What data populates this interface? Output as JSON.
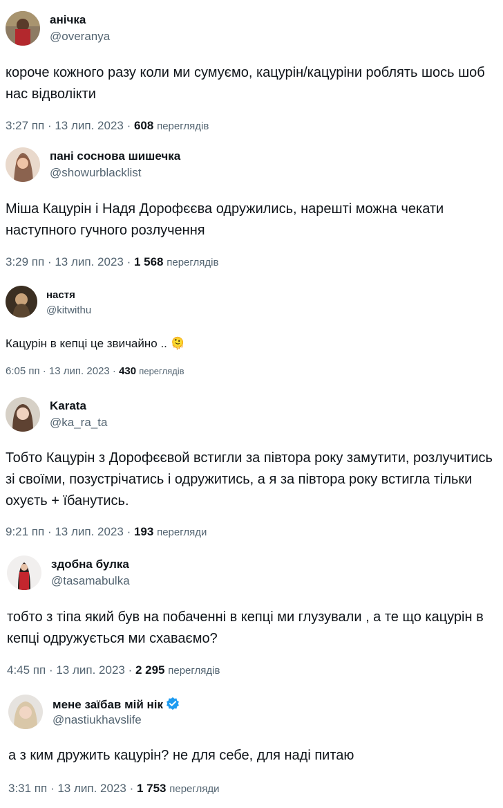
{
  "tweets": [
    {
      "name": "анічка",
      "handle": "@overanya",
      "text": "короче кожного разу коли ми сумуємо, кацурін/кацуріни роблять шось шоб нас відволікти",
      "time": "3:27 пп · 13 лип. 2023 ·",
      "views": "608",
      "views_label": "переглядів"
    },
    {
      "name": "пані соснова шишечка",
      "handle": "@showurblacklist",
      "text": "Міша Кацурін і Надя Дорофєєва одружились, нарешті можна чекати наступного гучного розлучення",
      "time": "3:29 пп · 13 лип. 2023 ·",
      "views": "1 568",
      "views_label": "переглядів"
    },
    {
      "name": "настя",
      "handle": "@kitwithu",
      "text": "Кацурін в кепці це звичайно ..",
      "emoji": "🫠",
      "time": "6:05 пп · 13 лип. 2023 ·",
      "views": "430",
      "views_label": "переглядів"
    },
    {
      "name": "Karata",
      "handle": "@ka_ra_ta",
      "text": "Тобто Кацурін з Дорофєєвой встигли за півтора року замутити, розлучитись зі своїми, позустрічатись і одружитись, а я за півтора року встигла тільки охуєть + їбанутись.",
      "time": "9:21 пп · 13 лип. 2023 ·",
      "views": "193",
      "views_label": "перегляди"
    },
    {
      "name": "здобна булка",
      "handle": "@tasamabulka",
      "text": "тобто з тіпа який був на побаченні в кепці ми глузували , а те що кацурін в кепці одружується ми схаваємо?",
      "time": "4:45 пп · 13 лип. 2023 ·",
      "views": "2 295",
      "views_label": "переглядів"
    },
    {
      "name": "мене заїбав мій нік",
      "handle": "@nastiukhavslife",
      "text": "а з ким дружить кацурін? не для себе, для наді питаю",
      "time": "3:31 пп · 13 лип. 2023 ·",
      "views": "1 753",
      "views_label": "перегляди",
      "verified_icon": "verified-badge-icon"
    }
  ]
}
